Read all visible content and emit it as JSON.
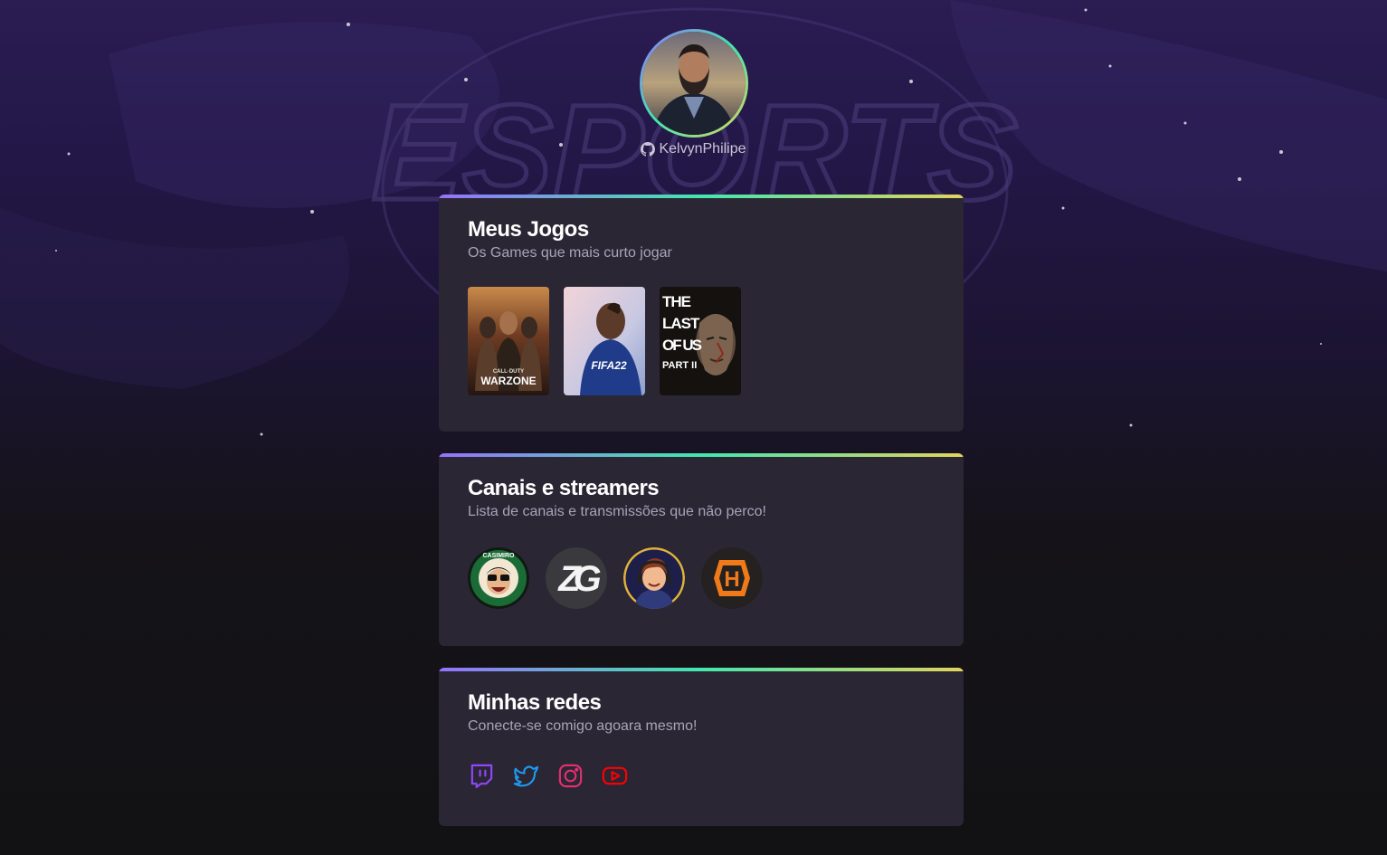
{
  "background": {
    "logo_text": "ESPORTS",
    "accent": "#9572fc"
  },
  "profile": {
    "username": "KelvynPhilipe",
    "github_icon": "github-icon",
    "ring_colors": [
      "#9572fc",
      "#43e7ad",
      "#e2d45c"
    ]
  },
  "games_section": {
    "title": "Meus Jogos",
    "subtitle": "Os Games que mais curto jogar",
    "games": [
      {
        "name": "CALL OF DUTY WARZONE",
        "title_lines": [
          "CALL·DUTY",
          "WARZONE"
        ]
      },
      {
        "name": "FIFA 22",
        "title_lines": [
          "FIFA22"
        ]
      },
      {
        "name": "THE LAST OF US PART II",
        "title_lines": [
          "THE",
          "LAST",
          "OF US",
          "PART II"
        ]
      }
    ]
  },
  "channels_section": {
    "title": "Canais e streamers",
    "subtitle": "Lista de canais e transmissões que não perco!",
    "channels": [
      {
        "name": "Casimiro",
        "badge_text": "CASIMIRO"
      },
      {
        "name": "ZG",
        "badge_text": "ZG"
      },
      {
        "name": "streamer-avatar",
        "badge_text": ""
      },
      {
        "name": "H",
        "badge_text": "H"
      }
    ]
  },
  "networks_section": {
    "title": "Minhas redes",
    "subtitle": "Conecte-se comigo agoara mesmo!",
    "networks": [
      {
        "name": "twitch",
        "icon": "twitch-icon",
        "color": "#9146ff"
      },
      {
        "name": "twitter",
        "icon": "twitter-icon",
        "color": "#1d9bf0"
      },
      {
        "name": "instagram",
        "icon": "instagram-icon",
        "color": "#e1306c"
      },
      {
        "name": "youtube",
        "icon": "youtube-icon",
        "color": "#ff0000"
      }
    ]
  }
}
